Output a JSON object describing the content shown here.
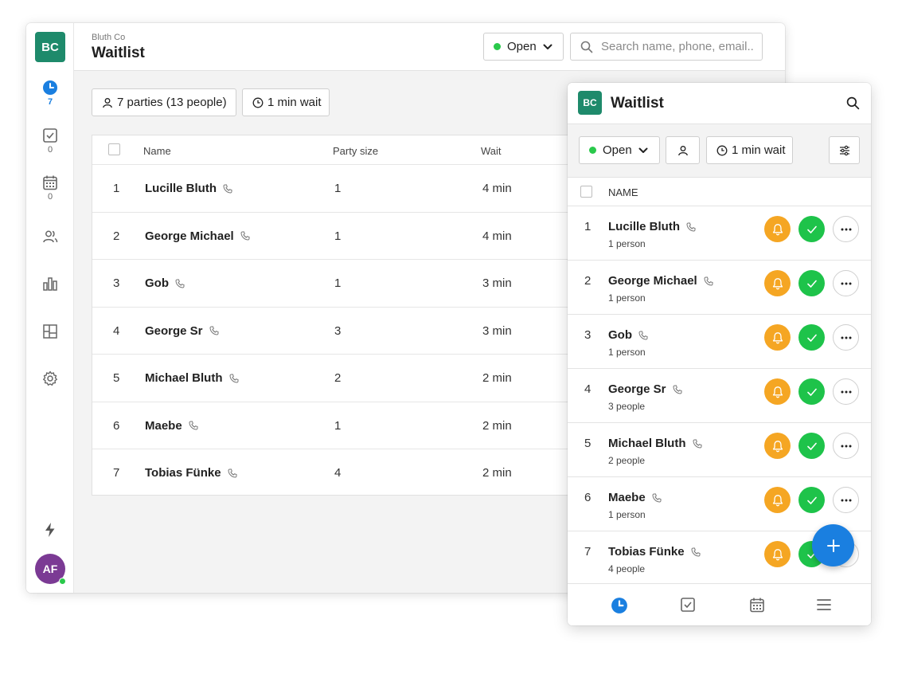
{
  "desktop": {
    "logo": "BC",
    "org_name": "Bluth Co",
    "title": "Waitlist",
    "status_label": "Open",
    "search_placeholder": "Search name, phone, email..",
    "summary_parties": "7 parties (13 people)",
    "summary_wait": "1 min wait",
    "sidebar": {
      "waitlist_count": "7",
      "tasks_count": "0",
      "calendar_count": "0"
    },
    "avatar": "AF",
    "columns": {
      "name": "Name",
      "party_size": "Party size",
      "wait": "Wait"
    },
    "rows": [
      {
        "num": "1",
        "name": "Lucille Bluth",
        "party": "1",
        "wait": "4 min"
      },
      {
        "num": "2",
        "name": "George Michael",
        "party": "1",
        "wait": "4 min"
      },
      {
        "num": "3",
        "name": "Gob",
        "party": "1",
        "wait": "3 min"
      },
      {
        "num": "4",
        "name": "George Sr",
        "party": "3",
        "wait": "3 min"
      },
      {
        "num": "5",
        "name": "Michael Bluth",
        "party": "2",
        "wait": "2 min"
      },
      {
        "num": "6",
        "name": "Maebe",
        "party": "1",
        "wait": "2 min"
      },
      {
        "num": "7",
        "name": "Tobias Fünke",
        "party": "4",
        "wait": "2 min"
      }
    ]
  },
  "mobile": {
    "logo": "BC",
    "title": "Waitlist",
    "status_label": "Open",
    "wait_label": "1 min wait",
    "column_name": "NAME",
    "rows": [
      {
        "num": "1",
        "name": "Lucille Bluth",
        "sub": "1 person"
      },
      {
        "num": "2",
        "name": "George Michael",
        "sub": "1 person"
      },
      {
        "num": "3",
        "name": "Gob",
        "sub": "1 person"
      },
      {
        "num": "4",
        "name": "George Sr",
        "sub": "3 people"
      },
      {
        "num": "5",
        "name": "Michael Bluth",
        "sub": "2 people"
      },
      {
        "num": "6",
        "name": "Maebe",
        "sub": "1 person"
      },
      {
        "num": "7",
        "name": "Tobias Fünke",
        "sub": "4 people"
      }
    ]
  },
  "colors": {
    "brand": "#1e8a6b",
    "accent": "#1a7fe0",
    "notify": "#f5a623",
    "seat": "#1ec34a",
    "online": "#2ac94b",
    "avatar": "#7b3a94"
  },
  "icons": [
    "clock-icon",
    "checkbox-icon",
    "calendar-icon",
    "people-icon",
    "chart-icon",
    "layout-icon",
    "gear-icon",
    "bolt-icon",
    "search-icon",
    "chevron-down-icon",
    "person-icon",
    "phone-icon",
    "bell-icon",
    "check-icon",
    "more-icon",
    "plus-icon",
    "filter-icon",
    "menu-icon"
  ]
}
